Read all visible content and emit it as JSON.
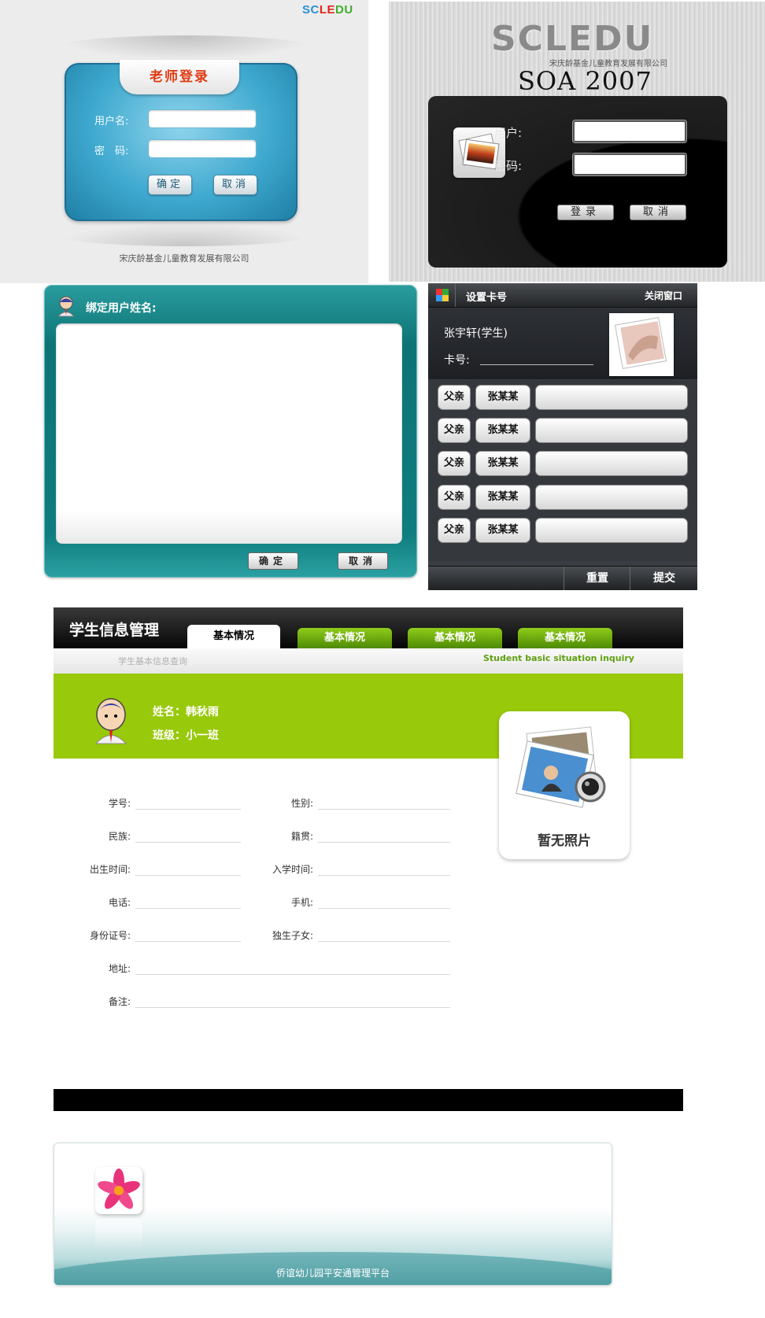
{
  "teacher_login": {
    "brand": {
      "sc": "SC",
      "le": "LE",
      "du": "DU"
    },
    "brand_colors": {
      "sc": "#2a8fd6",
      "le": "#e0261a",
      "du": "#3fae2a"
    },
    "title": "老师登录",
    "username_label": "用户名:",
    "password_label": "密　码:",
    "confirm_button": "确定",
    "cancel_button": "取消",
    "company": "宋庆龄基金儿童教育发展有限公司"
  },
  "soa_login": {
    "brand": "SCLEDU",
    "brand_sub": "宋庆龄基金儿童教育发展有限公司",
    "product": "SOA 2007",
    "user_label": "用户:",
    "password_label": "密码:",
    "login_button": "登录",
    "cancel_button": "取消"
  },
  "bind_user": {
    "title": "绑定用户姓名:",
    "confirm_button": "确定",
    "cancel_button": "取消"
  },
  "set_card": {
    "title": "设置卡号",
    "close": "关闭窗口",
    "student_name": "张宇轩(学生)",
    "card_label": "卡号:",
    "rows": [
      {
        "relation": "父亲",
        "name": "张某某"
      },
      {
        "relation": "父亲",
        "name": "张某某"
      },
      {
        "relation": "父亲",
        "name": "张某某"
      },
      {
        "relation": "父亲",
        "name": "张某某"
      },
      {
        "relation": "父亲",
        "name": "张某某"
      }
    ],
    "reset_button": "重置",
    "submit_button": "提交"
  },
  "student_info": {
    "app_title": "学生信息管理",
    "tabs": [
      "基本情况",
      "基本情况",
      "基本情况",
      "基本情况"
    ],
    "subtitle_cn": "学生基本信息查询",
    "subtitle_en": "Student basic situation inquiry",
    "name_line": "姓名：韩秋雨",
    "class_line": "班级：小一班",
    "no_photo": "暂无照片",
    "fields_left": [
      "学号:",
      "民族:",
      "出生时间:",
      "电话:",
      "身份证号:",
      "地址:",
      "备注:"
    ],
    "fields_right": [
      "性别:",
      "籍贯:",
      "入学时间:",
      "手机:",
      "独生子女:"
    ]
  },
  "banner": {
    "caption": "侨谊幼儿园平安通管理平台"
  }
}
